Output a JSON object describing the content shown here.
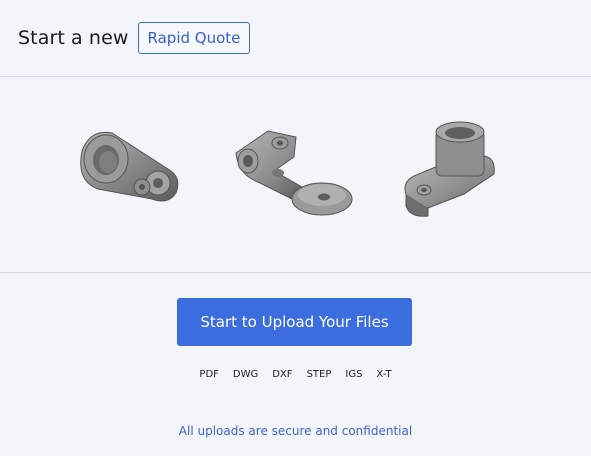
{
  "header": {
    "text": "Start a new",
    "badge": "Rapid Quote"
  },
  "gallery": {
    "parts": [
      {
        "name": "cam-lever-part"
      },
      {
        "name": "bracket-arm-part"
      },
      {
        "name": "boss-flange-part"
      }
    ],
    "colors": {
      "metal": "#8e8e8e",
      "metal_dark": "#5e5e5e",
      "metal_light": "#b8b8b8"
    }
  },
  "upload": {
    "button_label": "Start to Upload Your Files",
    "formats": [
      "PDF",
      "DWG",
      "DXF",
      "STEP",
      "IGS",
      "X-T"
    ],
    "secure_note": "All uploads are secure and confidential"
  },
  "theme": {
    "accent": "#3b6ddf",
    "background": "#f4f5fa",
    "divider": "#d3d8e4"
  }
}
